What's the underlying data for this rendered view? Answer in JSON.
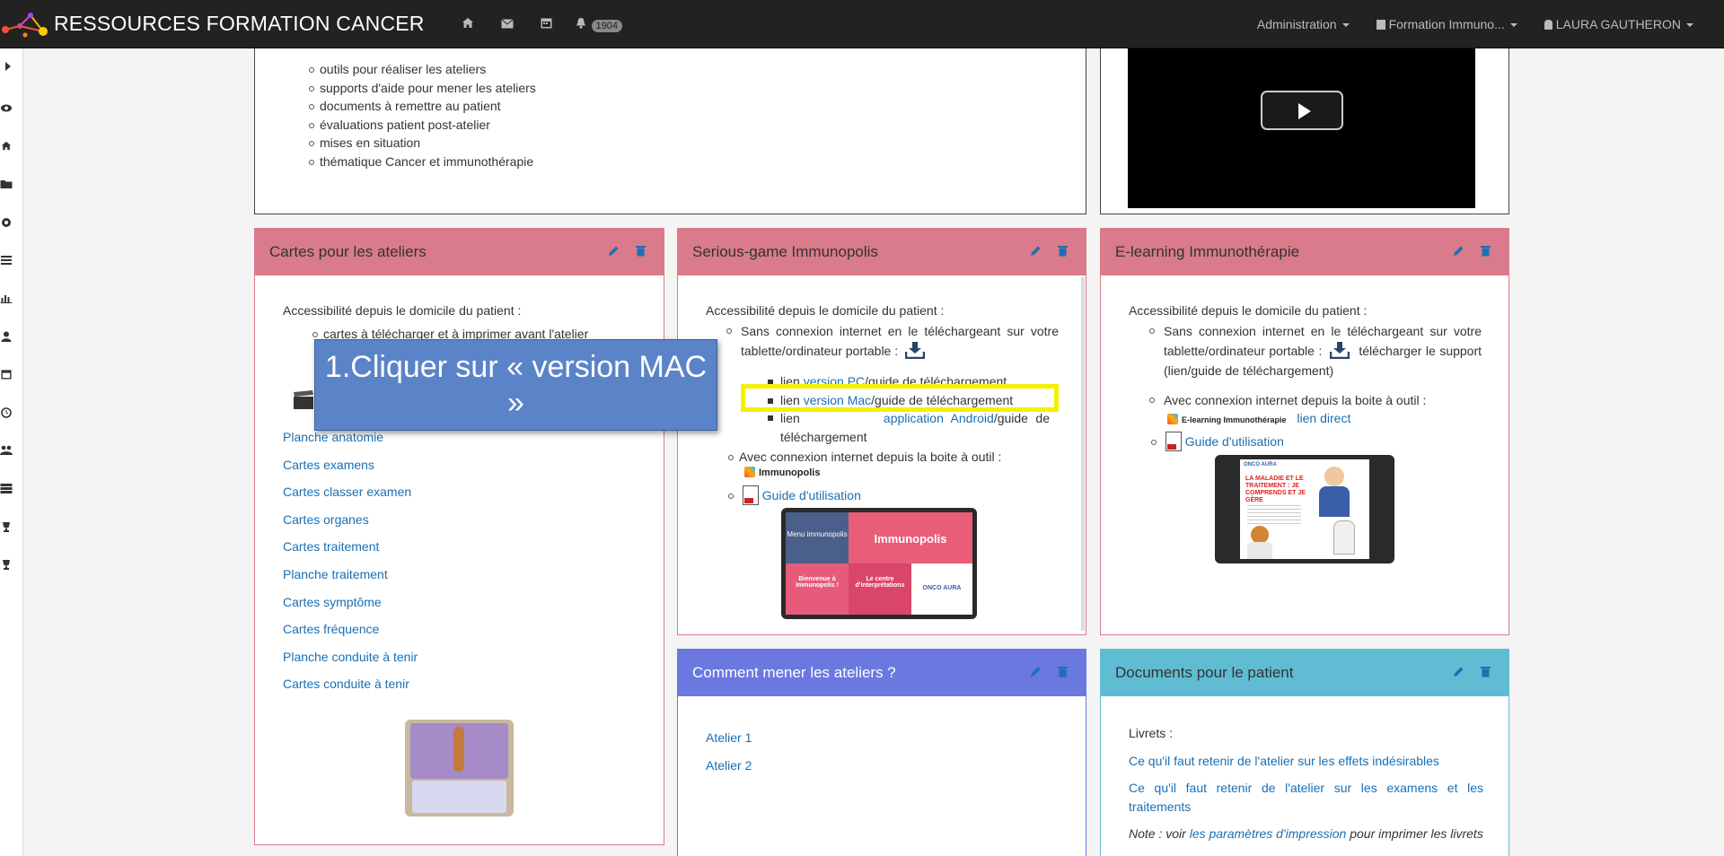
{
  "navbar": {
    "brand": "RESSOURCES FORMATION CANCER",
    "notifications_count": "1904",
    "menus": [
      "Administration",
      "Formation Immuno...",
      "LAURA GAUTHERON"
    ],
    "icons": [
      "home-icon",
      "envelope-icon",
      "calendar-icon",
      "bell-icon"
    ]
  },
  "sidebar": {
    "icons": [
      "caret-right-icon",
      "eye-icon",
      "home-icon",
      "folder-icon",
      "gear-icon",
      "list-icon",
      "bar-chart-icon",
      "user-icon",
      "calendar-icon",
      "clock-icon",
      "users-icon",
      "server-icon",
      "trophy-icon",
      "trophy-icon"
    ]
  },
  "top_section": {
    "items": [
      "outils pour réaliser les ateliers",
      "supports d'aide pour mener les ateliers",
      "documents à remettre au patient",
      "évaluations patient post-atelier",
      "mises en situation",
      "thématique Cancer et immunothérapie"
    ]
  },
  "cartes": {
    "title": "Cartes pour les ateliers",
    "intro": "Accessibilité depuis le domicile du patient :",
    "partial_item": "cartes à télécharger et à imprimer avant l'atelier",
    "links": [
      "Planche anatomie",
      "Cartes examens",
      "Cartes classer examen",
      "Cartes organes",
      "Cartes traitement",
      "Planche traitement",
      "Cartes symptôme",
      "Cartes fréquence",
      "Planche conduite à tenir",
      "Cartes conduite à tenir"
    ]
  },
  "serious_game": {
    "title": "Serious-game Immunopolis",
    "intro": "Accessibilité depuis le domicile du patient :",
    "offline": "Sans connexion internet en le téléchargeant sur votre tablette/ordinateur portable :",
    "pc_prefix": "lien ",
    "pc_link": "version PC",
    "pc_suffix": "/guide de téléchargement",
    "mac_prefix": "lien ",
    "mac_link": "version Mac",
    "mac_suffix": "/guide de téléchargement",
    "android_prefix": "lien",
    "android_link": "application Android",
    "android_suffix": "/guide de téléchargement",
    "online": "Avec connexion internet depuis la boite à outil :",
    "tool_label": "Immunopolis",
    "guide": "Guide d'utilisation",
    "thumb_title": "Immunopolis",
    "thumb_menu": "Menu immunopolis",
    "thumb_welcome": "Bienvenue à Immunopolis !",
    "thumb_center": "Le centre d'interprétations",
    "thumb_logo": "ONCO AURA"
  },
  "elearning": {
    "title": "E-learning Immunothérapie",
    "intro": "Accessibilité depuis le domicile du patient :",
    "offline": "Sans connexion internet en le téléchargeant sur votre tablette/ordinateur portable :",
    "offline_suffix": "télécharger le support (lien/guide de téléchargement)",
    "online": "Avec connexion internet depuis la boite à outil :",
    "tool_label": "E-learning Immunothérapie",
    "direct_link": "lien direct",
    "guide": "Guide d'utilisation",
    "thumb_logo": "ONCO AURA",
    "thumb_text": "LA MALADIE ET LE TRAITEMENT : JE COMPRENDS ET JE GÈRE"
  },
  "ateliers": {
    "title": "Comment mener les ateliers ?",
    "links": [
      "Atelier 1",
      "Atelier 2"
    ]
  },
  "documents": {
    "title": "Documents pour le patient",
    "intro": "Livrets :",
    "links": [
      "Ce qu'il faut retenir de l'atelier sur les effets indésirables",
      "Ce qu'il faut retenir de l'atelier sur les examens et les traitements"
    ],
    "note_prefix": "Note : voir ",
    "note_link": "les paramètres d'impression",
    "note_suffix": " pour imprimer les livrets"
  },
  "tooltip": {
    "text": "1.Cliquer sur « version MAC »"
  },
  "colors": {
    "navbar_bg": "#222222",
    "head_pink": "#d97b8a",
    "head_blue": "#6a78e0",
    "head_cyan": "#5fbcd3",
    "link": "#1a6fb5",
    "highlight": "#f5f000",
    "tooltip_bg": "#5b84c8"
  }
}
